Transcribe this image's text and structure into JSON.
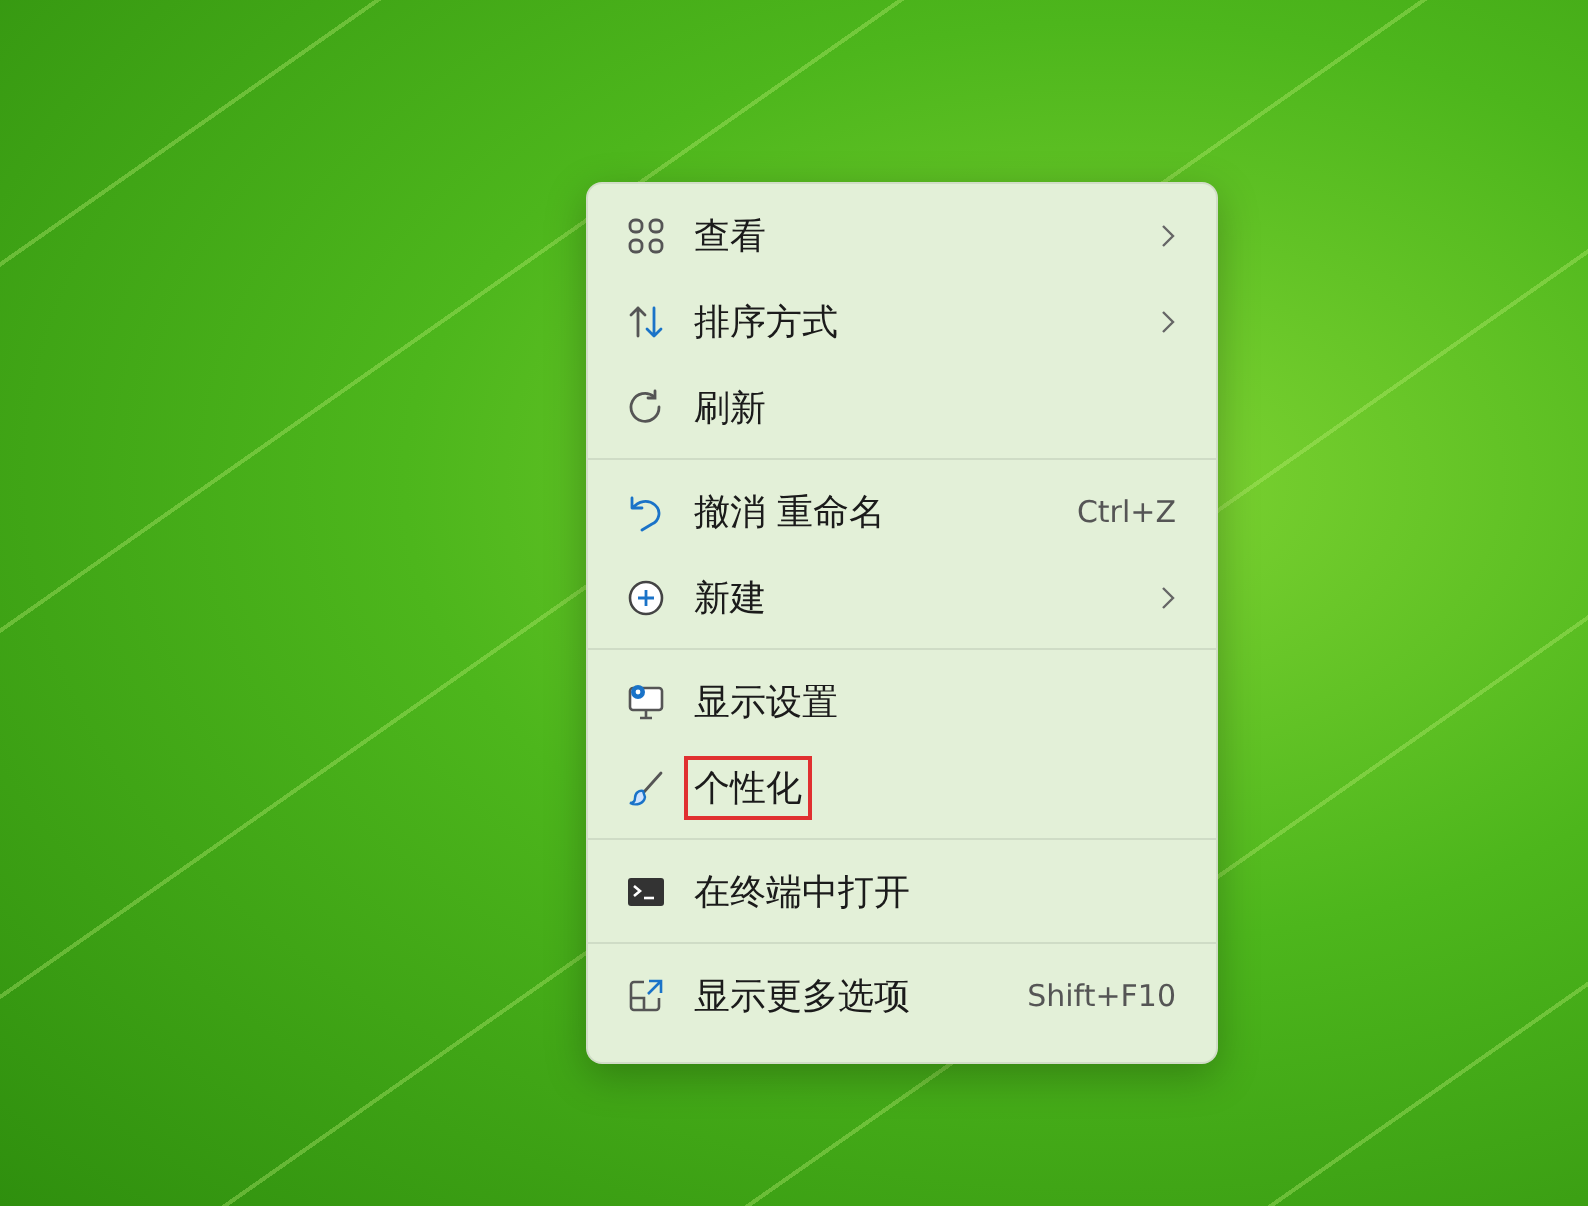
{
  "context_menu": {
    "groups": [
      [
        {
          "kind": "grid",
          "label": "查看",
          "submenu": true,
          "highlighted": false
        },
        {
          "kind": "sort",
          "label": "排序方式",
          "submenu": true,
          "highlighted": false
        },
        {
          "kind": "refresh",
          "label": "刷新",
          "submenu": false,
          "highlighted": false
        }
      ],
      [
        {
          "kind": "undo",
          "label": "撤消 重命名",
          "shortcut": "Ctrl+Z",
          "submenu": false,
          "highlighted": false
        },
        {
          "kind": "new",
          "label": "新建",
          "submenu": true,
          "highlighted": false
        }
      ],
      [
        {
          "kind": "display",
          "label": "显示设置",
          "submenu": false,
          "highlighted": false
        },
        {
          "kind": "brush",
          "label": "个性化",
          "submenu": false,
          "highlighted": true
        }
      ],
      [
        {
          "kind": "terminal",
          "label": "在终端中打开",
          "submenu": false,
          "highlighted": false
        }
      ],
      [
        {
          "kind": "more",
          "label": "显示更多选项",
          "shortcut": "Shift+F10",
          "submenu": false,
          "highlighted": false
        }
      ]
    ]
  }
}
